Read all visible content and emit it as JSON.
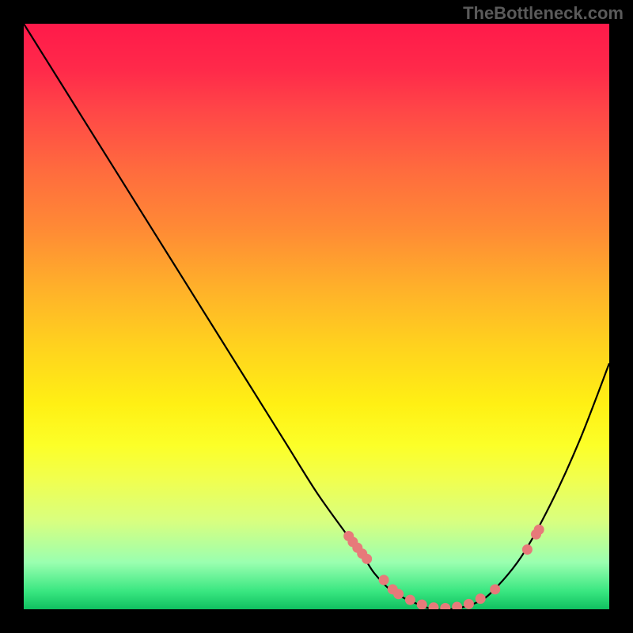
{
  "watermark": "TheBottleneck.com",
  "chart_data": {
    "type": "line",
    "title": "",
    "xlabel": "",
    "ylabel": "",
    "xlim": [
      0,
      100
    ],
    "ylim": [
      0,
      100
    ],
    "series": [
      {
        "name": "bottleneck-curve",
        "x": [
          0,
          5,
          10,
          15,
          20,
          25,
          30,
          35,
          40,
          45,
          50,
          55,
          58,
          60,
          63,
          67,
          70,
          73,
          77,
          80,
          85,
          90,
          95,
          100
        ],
        "y": [
          100,
          92,
          84,
          76,
          68,
          60,
          52,
          44,
          36,
          28,
          20,
          13,
          9,
          6,
          3,
          1,
          0,
          0,
          1,
          3,
          9,
          18,
          29,
          42
        ]
      }
    ],
    "markers": {
      "name": "highlight-points",
      "color": "#e77a7a",
      "x": [
        55.5,
        56.2,
        57.0,
        57.8,
        58.6,
        61.5,
        63.0,
        64.0,
        66.0,
        68.0,
        70.0,
        72.0,
        74.0,
        76.0,
        78.0,
        80.5,
        86.0,
        87.5,
        88.0
      ],
      "y": [
        12.5,
        11.5,
        10.5,
        9.5,
        8.6,
        5.0,
        3.4,
        2.6,
        1.6,
        0.8,
        0.3,
        0.2,
        0.4,
        0.9,
        1.8,
        3.4,
        10.2,
        12.8,
        13.6
      ]
    },
    "gradient_stops": [
      {
        "pos": 0,
        "color": "#ff1a4a"
      },
      {
        "pos": 50,
        "color": "#ffd21e"
      },
      {
        "pos": 100,
        "color": "#10c060"
      }
    ]
  }
}
